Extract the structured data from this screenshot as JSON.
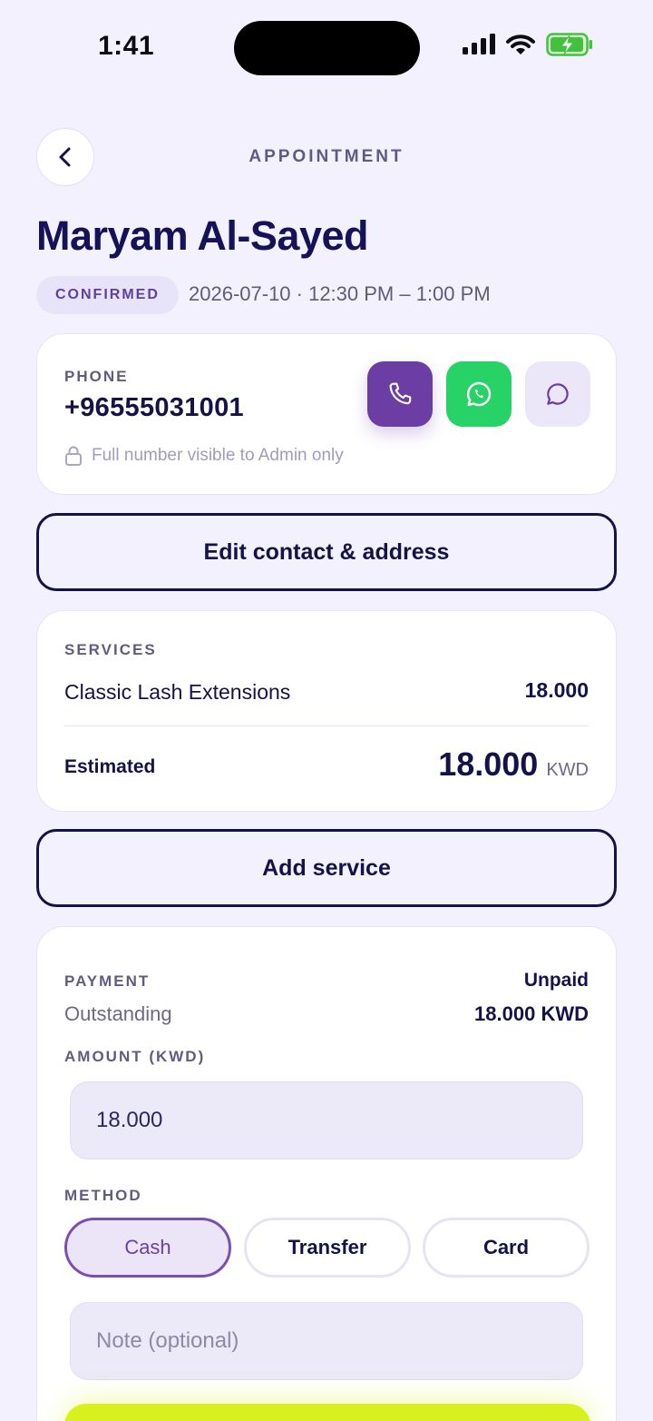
{
  "status_bar": {
    "time": "1:41"
  },
  "header": {
    "title": "APPOINTMENT"
  },
  "client": {
    "name": "Maryam Al-Sayed"
  },
  "appointment": {
    "status": "CONFIRMED",
    "datetime": "2026-07-10 · 12:30 PM – 1:00 PM"
  },
  "phone": {
    "label": "PHONE",
    "number": "+96555031001",
    "note": "Full number visible to Admin only"
  },
  "buttons": {
    "edit_contact": "Edit contact & address",
    "add_service": "Add service"
  },
  "services": {
    "label": "SERVICES",
    "items": [
      {
        "name": "Classic Lash Extensions",
        "price": "18.000"
      }
    ],
    "estimated_label": "Estimated",
    "estimated_amount": "18.000",
    "currency": "KWD"
  },
  "payment": {
    "label": "PAYMENT",
    "status": "Unpaid",
    "outstanding_label": "Outstanding",
    "outstanding_value": "18.000 KWD",
    "amount_label": "AMOUNT (KWD)",
    "amount_value": "18.000",
    "method_label": "METHOD",
    "methods": [
      "Cash",
      "Transfer",
      "Card"
    ],
    "selected_method": "Cash",
    "note_placeholder": "Note (optional)"
  },
  "colors": {
    "background": "#f3f1fd",
    "primary_purple": "#6c3ea3",
    "whatsapp_green": "#27d366",
    "navy_text": "#15124a",
    "accent_lime": "#d8f01d"
  }
}
